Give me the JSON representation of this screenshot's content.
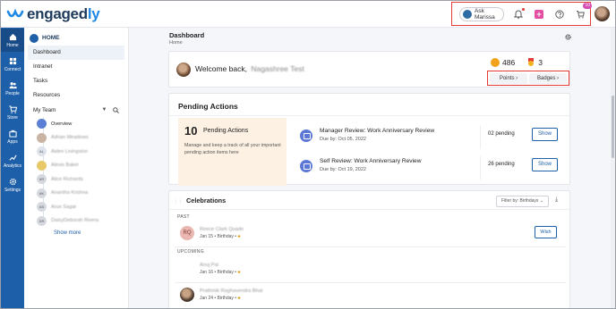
{
  "app": {
    "logo_main": "engaged",
    "logo_accent": "ly"
  },
  "topbar": {
    "ask_label": "Ask Marissa",
    "bell_icon": "bell-icon",
    "plus_icon": "plus-square-icon",
    "help_icon": "help-circle-icon",
    "cart_icon": "cart-icon",
    "cart_badge": "10",
    "highlight_color": "#e53935"
  },
  "rail": {
    "items": [
      {
        "label": "Home",
        "icon": "home-icon"
      },
      {
        "label": "Connect",
        "icon": "connect-icon"
      },
      {
        "label": "People",
        "icon": "people-icon"
      },
      {
        "label": "Store",
        "icon": "store-icon"
      },
      {
        "label": "Apps",
        "icon": "apps-icon"
      },
      {
        "label": "Analytics",
        "icon": "analytics-icon"
      },
      {
        "label": "Settings",
        "icon": "settings-icon"
      }
    ],
    "color": "#1d5fa8"
  },
  "sidebar": {
    "header": "HOME",
    "items": [
      "Dashboard",
      "Intranet",
      "Tasks",
      "Resources"
    ],
    "team_label": "My Team",
    "overview": "Overview",
    "members": [
      {
        "initials": "",
        "name": "Adrian Meadows"
      },
      {
        "initials": "AL",
        "name": "Aiden Livingston"
      },
      {
        "initials": "",
        "name": "Alexis Baker"
      },
      {
        "initials": "AR",
        "name": "Alice Richards"
      },
      {
        "initials": "AK",
        "name": "Anantha Krishna"
      },
      {
        "initials": "AS",
        "name": "Arun Sagar"
      },
      {
        "initials": "DR",
        "name": "DaisyDeborah Rivera"
      }
    ],
    "show_more": "Show more"
  },
  "page": {
    "title": "Dashboard",
    "breadcrumb": "Home"
  },
  "welcome": {
    "greeting": "Welcome back,",
    "name": "Nagashree Test",
    "points": "486",
    "badges": "3",
    "points_btn": "Points",
    "badges_btn": "Badges"
  },
  "pending": {
    "title": "Pending Actions",
    "count": "10",
    "count_label": "Pending Actions",
    "description": "Manage and keep a track of all your important pending action items here",
    "rows": [
      {
        "title": "Manager Review: Work Anniversary Review",
        "due": "Due by: Oct 05, 2022",
        "count": "02 pending",
        "action": "Show"
      },
      {
        "title": "Self Review: Work Anniversary Review",
        "due": "Due by: Oct 19, 2022",
        "count": "26 pending",
        "action": "Show"
      }
    ]
  },
  "celebrations": {
    "title": "Celebrations",
    "filter": "Filter by: Birthdays",
    "past_label": "PAST",
    "upcoming_label": "UPCOMING",
    "past": [
      {
        "initials": "RQ",
        "name": "Reece Clark Quade",
        "date": "Jan 15",
        "type": "Birthday",
        "action": "Wish"
      }
    ],
    "upcoming": [
      {
        "name": "Anuj Pal",
        "date": "Jan 16",
        "type": "Birthday"
      },
      {
        "name": "Prathmik Raghavendra Bhat",
        "date": "Jan 24",
        "type": "Birthday"
      }
    ]
  }
}
